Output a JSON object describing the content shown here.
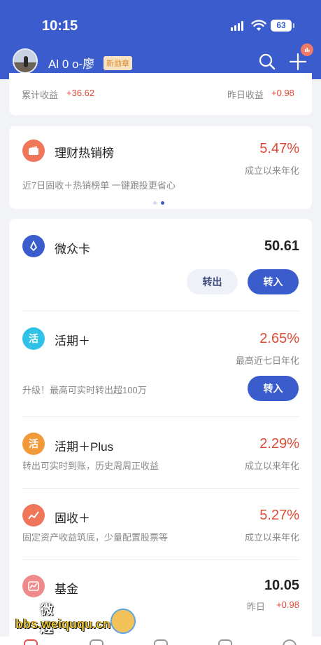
{
  "status": {
    "time": "10:15",
    "battery": "63"
  },
  "user": {
    "name": "Al 0 o-廖",
    "badge": "新勋章"
  },
  "summary": {
    "total_label": "累计收益",
    "total_value": "+36.62",
    "yesterday_label": "昨日收益",
    "yesterday_value": "+0.98"
  },
  "hot": {
    "title": "理财热销榜",
    "rate": "5.47%",
    "rate_label": "成立以来年化",
    "desc": "近7日固收＋热销榜单 一键跟投更省心"
  },
  "products": {
    "weizhong": {
      "title": "微众卡",
      "value": "50.61",
      "out_label": "转出",
      "in_label": "转入"
    },
    "huoqi": {
      "title": "活期＋",
      "rate": "2.65%",
      "rate_label": "最高近七日年化",
      "desc": "升级！最高可实时转出超100万",
      "in_label": "转入"
    },
    "huoqiplus": {
      "title": "活期＋Plus",
      "rate": "2.29%",
      "rate_label": "成立以来年化",
      "desc": "转出可实时到账，历史周周正收益"
    },
    "gushou": {
      "title": "固收＋",
      "rate": "5.27%",
      "rate_label": "成立以来年化",
      "desc": "固定资产收益筑底，少量配置股票等"
    },
    "fund": {
      "title": "基金",
      "value": "10.05",
      "yesterday_label": "昨日",
      "yesterday_value": "+0.98"
    }
  },
  "watermark": {
    "title": "微趣趣",
    "url": "bbs.weiququ.cn"
  },
  "icons": {
    "huo": "活"
  },
  "colors": {
    "brand": "#3b5ccc",
    "positive": "#e04b35"
  }
}
